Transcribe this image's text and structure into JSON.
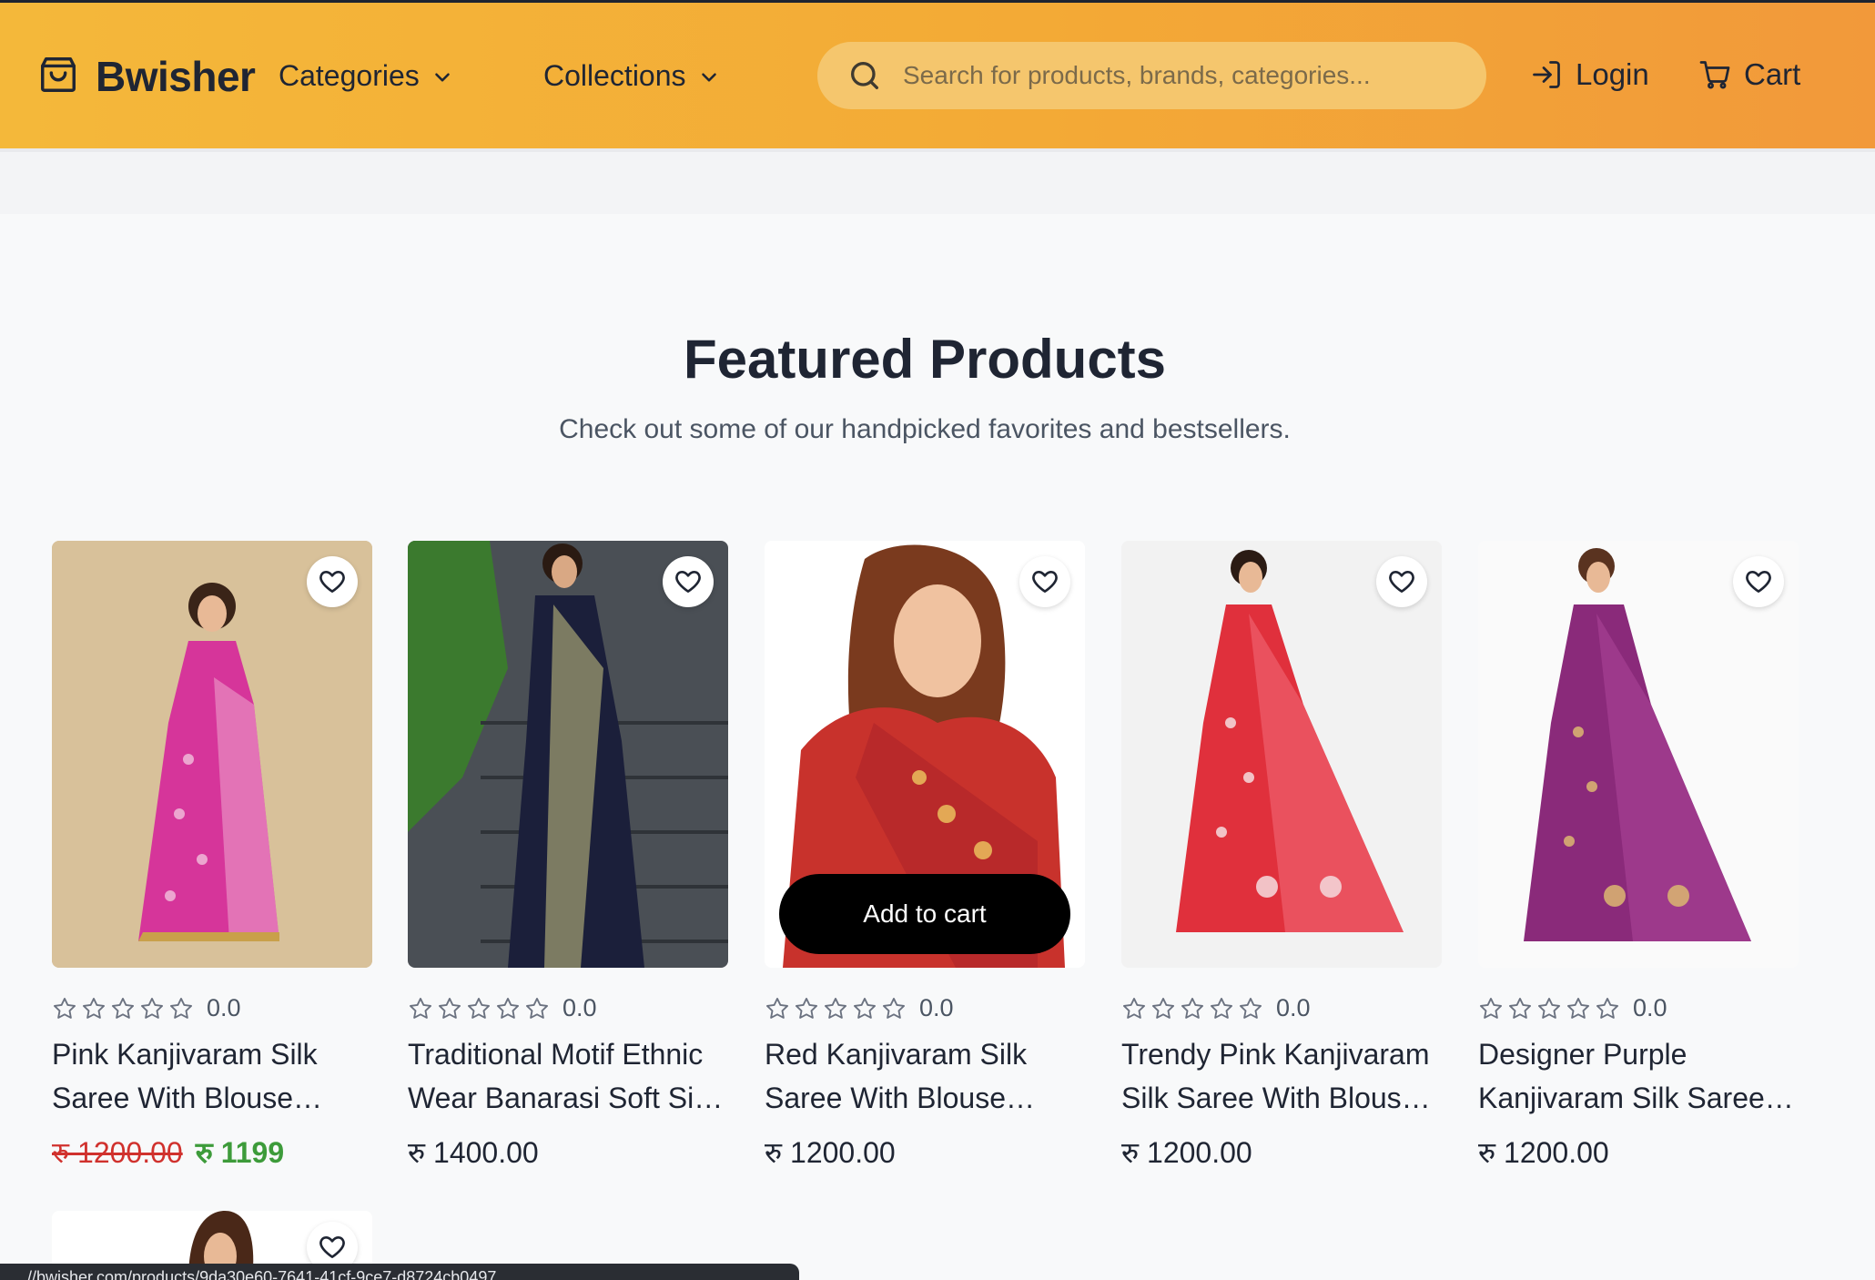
{
  "header": {
    "brand": "Bwisher",
    "nav": [
      {
        "label": "Categories"
      },
      {
        "label": "Collections"
      }
    ],
    "search_placeholder": "Search for products, brands, categories...",
    "login_label": "Login",
    "cart_label": "Cart"
  },
  "featured": {
    "title": "Featured Products",
    "subtitle": "Check out some of our handpicked favorites and bestsellers."
  },
  "products": [
    {
      "rating": "0.0",
      "title_line1": "Pink Kanjivaram Silk",
      "title_line2": "Saree With Blouse…",
      "old_price": "रु 1200.00",
      "price": "रु 1199"
    },
    {
      "rating": "0.0",
      "title_line1": "Traditional Motif Ethnic",
      "title_line2": "Wear Banarasi Soft Si…",
      "price": "रु 1400.00"
    },
    {
      "rating": "0.0",
      "title_line1": "Red Kanjivaram Silk",
      "title_line2": "Saree With Blouse…",
      "price": "रु 1200.00",
      "add_to_cart": "Add to cart"
    },
    {
      "rating": "0.0",
      "title_line1": "Trendy Pink Kanjivaram",
      "title_line2": "Silk Saree With Blous…",
      "price": "रु 1200.00"
    },
    {
      "rating": "0.0",
      "title_line1": "Designer Purple",
      "title_line2": "Kanjivaram Silk Saree…",
      "price": "रु 1200.00"
    }
  ],
  "status_url": "//bwisher.com/products/9da30e60-7641-41cf-9ce7-d8724cb0497",
  "colors": {
    "header_start": "#f4b83a",
    "header_end": "#f2993a",
    "sale_old": "#d0312d",
    "sale_new": "#3d9b3a"
  }
}
